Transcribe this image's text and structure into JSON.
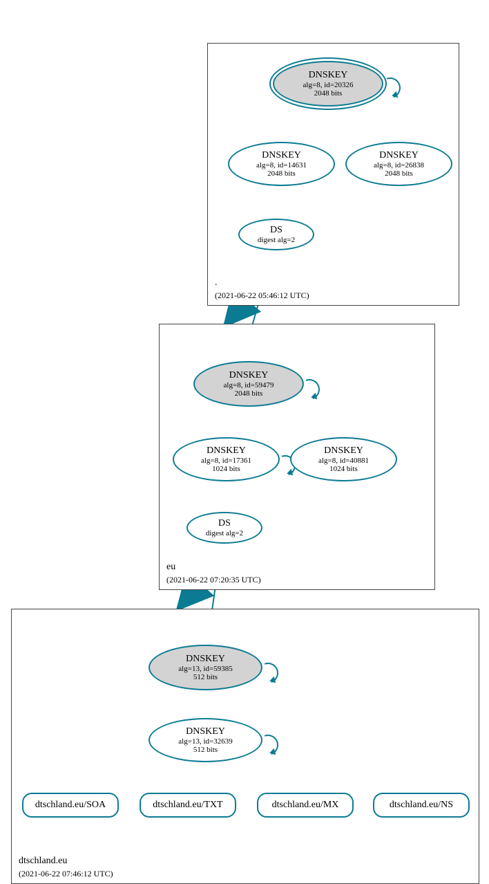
{
  "colors": {
    "stroke": "#0b7b93",
    "ksk_fill": "#d3d3d3"
  },
  "zones": {
    "root": {
      "name": ".",
      "timestamp": "(2021-06-22 05:46:12 UTC)"
    },
    "eu": {
      "name": "eu",
      "timestamp": "(2021-06-22 07:20:35 UTC)"
    },
    "domain": {
      "name": "dtschland.eu",
      "timestamp": "(2021-06-22 07:46:12 UTC)"
    }
  },
  "nodes": {
    "root_ksk": {
      "title": "DNSKEY",
      "line2": "alg=8, id=20326",
      "line3": "2048 bits"
    },
    "root_zsk1": {
      "title": "DNSKEY",
      "line2": "alg=8, id=14631",
      "line3": "2048 bits"
    },
    "root_zsk2": {
      "title": "DNSKEY",
      "line2": "alg=8, id=26838",
      "line3": "2048 bits"
    },
    "root_ds": {
      "title": "DS",
      "line2": "digest alg=2"
    },
    "eu_ksk": {
      "title": "DNSKEY",
      "line2": "alg=8, id=59479",
      "line3": "2048 bits"
    },
    "eu_zsk1": {
      "title": "DNSKEY",
      "line2": "alg=8, id=17361",
      "line3": "1024 bits"
    },
    "eu_zsk2": {
      "title": "DNSKEY",
      "line2": "alg=8, id=40881",
      "line3": "1024 bits"
    },
    "eu_ds": {
      "title": "DS",
      "line2": "digest alg=2"
    },
    "dom_ksk": {
      "title": "DNSKEY",
      "line2": "alg=13, id=59385",
      "line3": "512 bits"
    },
    "dom_zsk": {
      "title": "DNSKEY",
      "line2": "alg=13, id=32639",
      "line3": "512 bits"
    }
  },
  "rrsets": {
    "soa": "dtschland.eu/SOA",
    "txt": "dtschland.eu/TXT",
    "mx": "dtschland.eu/MX",
    "ns": "dtschland.eu/NS"
  }
}
